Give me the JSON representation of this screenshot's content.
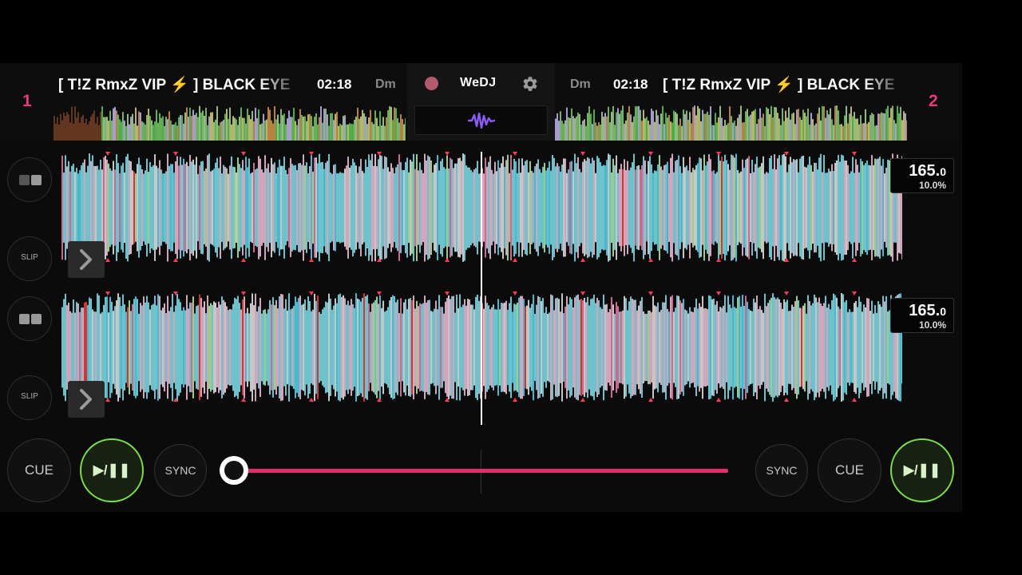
{
  "app": {
    "logo": "WeDJ"
  },
  "deck1": {
    "number": "1",
    "title": "[ T!Z RmxZ VIP ⚡ ] BLACK EYE",
    "time": "02:18",
    "key": "Dm",
    "bpm": "165.",
    "bpm_decimal": "0",
    "pitch": "10.0%",
    "cue_label": "CUE",
    "play_label": "▶/❚❚",
    "sync_label": "SYNC",
    "slip_label": "SLIP"
  },
  "deck2": {
    "number": "2",
    "title": "[ T!Z RmxZ VIP ⚡ ] BLACK EYE",
    "time": "02:18",
    "key": "Dm",
    "bpm": "165.",
    "bpm_decimal": "0",
    "pitch": "10.0%",
    "cue_label": "CUE",
    "play_label": "▶/❚❚",
    "sync_label": "SYNC",
    "slip_label": "SLIP"
  },
  "mixer": {
    "crossfader_position": 0.0
  },
  "icons": {
    "record": "record-icon",
    "settings": "gear-icon",
    "waveform": "waveform-icon",
    "expand": "chevron-right-icon",
    "deck_view": "deck-view-icon"
  },
  "colors": {
    "accent": "#e42d6a",
    "play_active": "#7be04a",
    "waveform_palette": [
      "#7fe3ee",
      "#f4c2dc",
      "#e8e8e8",
      "#56d8f0",
      "#f27aa8",
      "#b4f0a0",
      "#ff3b3b"
    ]
  }
}
